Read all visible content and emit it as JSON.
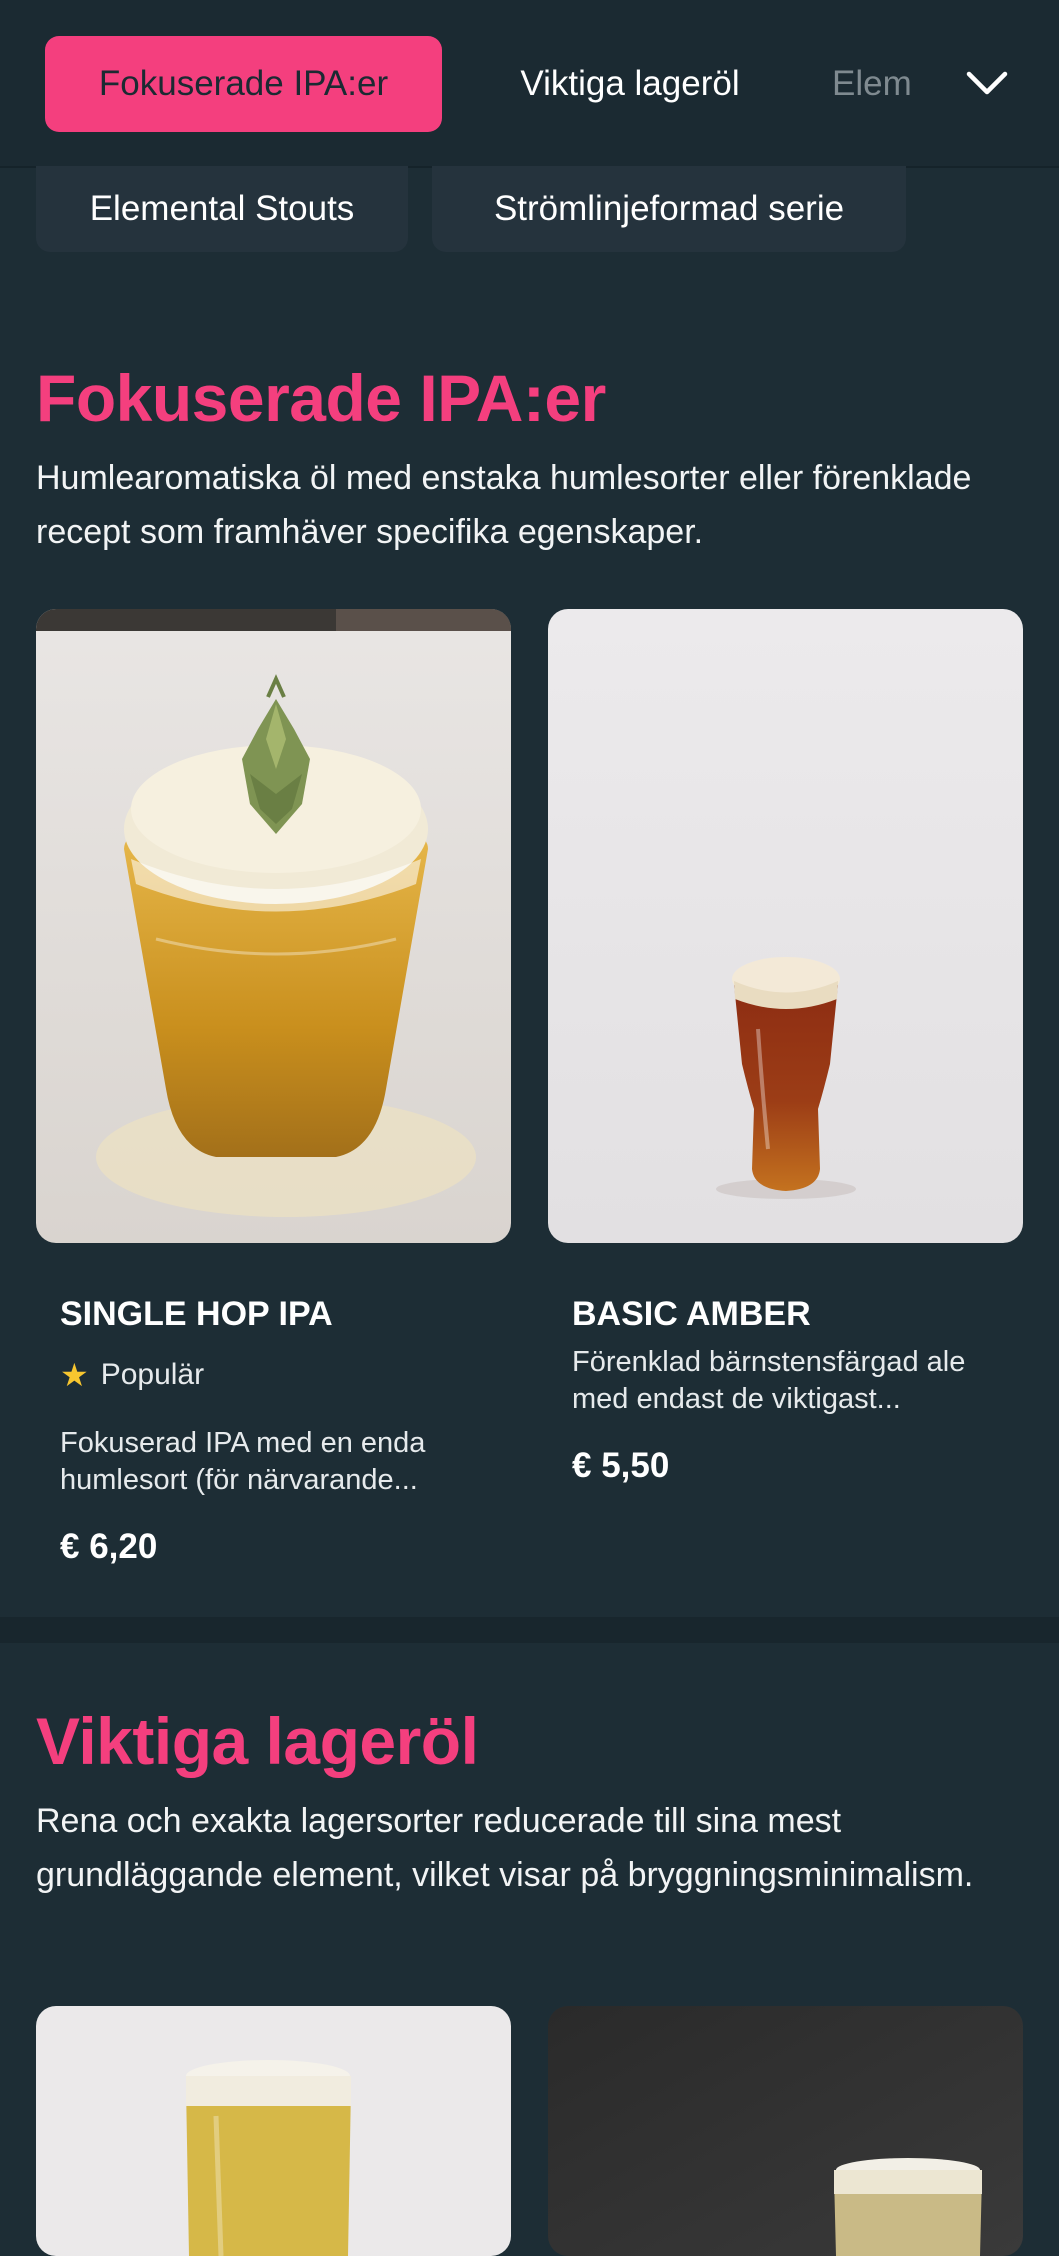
{
  "nav": {
    "tabs": [
      {
        "label": "Fokuserade IPA:er",
        "active": true
      },
      {
        "label": "Viktiga lageröl",
        "active": false
      },
      {
        "label": "Elem",
        "active": false
      }
    ],
    "expand_icon": "chevron-down-icon",
    "overflow_tabs": [
      {
        "label": "Elemental Stouts"
      },
      {
        "label": "Strömlinjeformad serie"
      }
    ]
  },
  "sections": [
    {
      "title": "Fokuserade IPA:er",
      "description": "Humlearomatiska öl med enstaka humlesorter eller förenklade recept som framhäver specifika egenskaper.",
      "products": [
        {
          "name": "SINGLE HOP IPA",
          "badge": "Populär",
          "badge_icon": "star-icon",
          "description": "Fokuserad IPA med en enda humlesort (för närvarande...",
          "price": "€ 6,20"
        },
        {
          "name": "BASIC AMBER",
          "description": "Förenklad bärnstensfärgad ale med endast de viktigast...",
          "price": "€ 5,50"
        }
      ]
    },
    {
      "title": "Viktiga lageröl",
      "description": "Rena och exakta lagersorter reducerade till sina mest grundläggande element, vilket visar på bryggningsminimalism."
    }
  ],
  "colors": {
    "accent": "#f43f7e",
    "background": "#1d2d35",
    "star": "#f7c62f"
  }
}
